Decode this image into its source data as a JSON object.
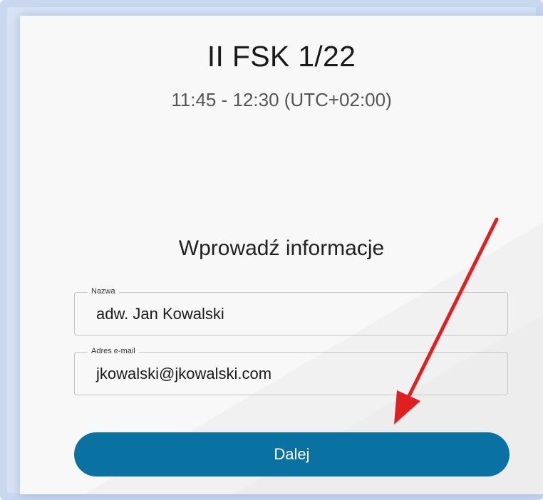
{
  "meeting": {
    "title": "II FSK 1/22",
    "time": "11:45 - 12:30 (UTC+02:00)"
  },
  "form": {
    "heading": "Wprowadź informacje",
    "name_label": "Nazwa",
    "name_value": "adw. Jan Kowalski",
    "email_label": "Adres e-mail",
    "email_value": "jkowalski@jkowalski.com",
    "submit_label": "Dalej"
  },
  "colors": {
    "button": "#0a72a2",
    "arrow": "#e02020",
    "frame": "#c9d8ef"
  }
}
